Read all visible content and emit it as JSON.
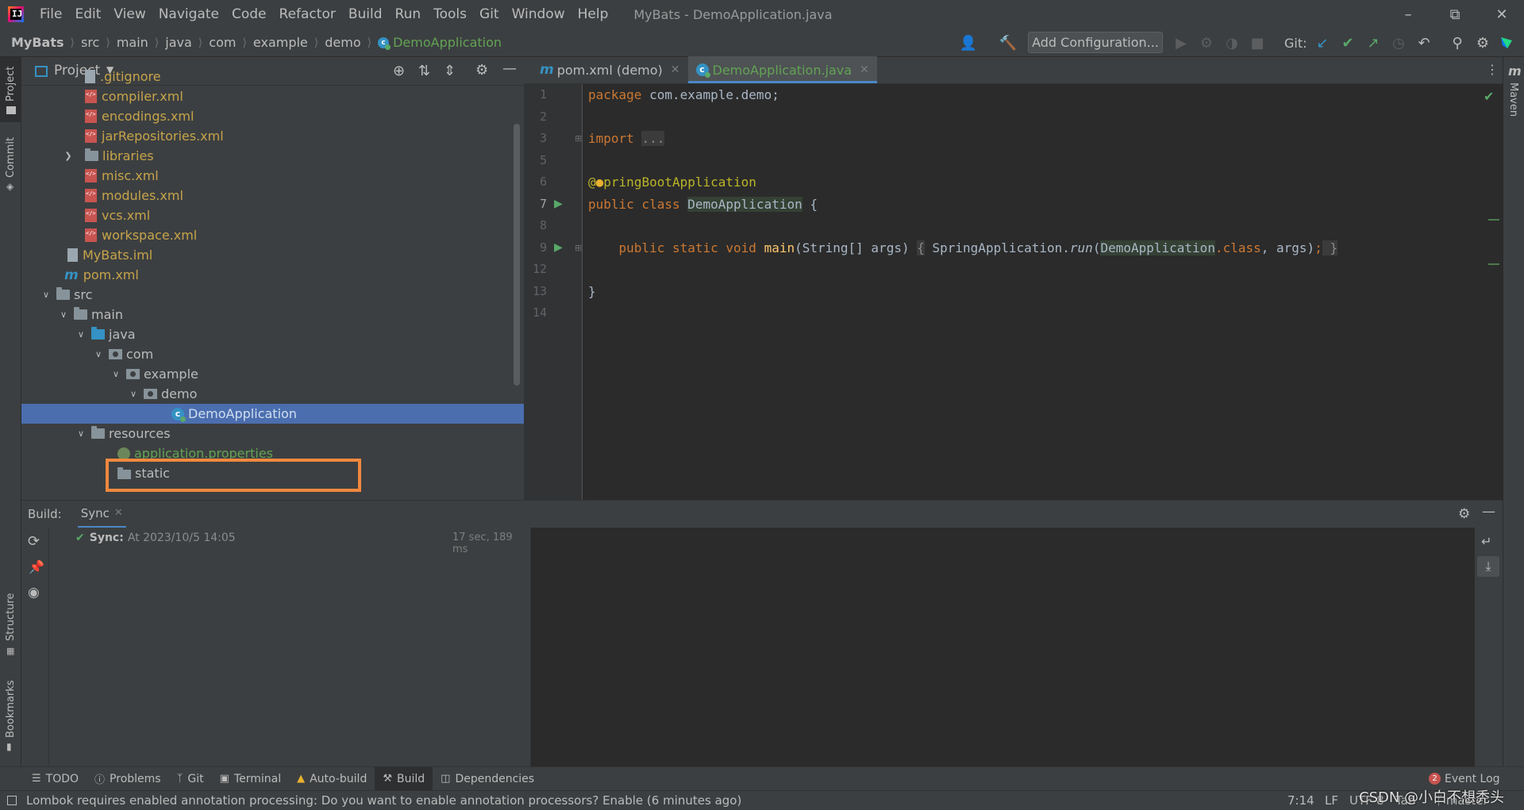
{
  "window": {
    "title": "MyBats - DemoApplication.java",
    "logo_letter": "IJ",
    "menu": [
      {
        "label": "File",
        "mnemonic": "F"
      },
      {
        "label": "Edit",
        "mnemonic": "E"
      },
      {
        "label": "View",
        "mnemonic": "V"
      },
      {
        "label": "Navigate",
        "mnemonic": "N"
      },
      {
        "label": "Code",
        "mnemonic": "C"
      },
      {
        "label": "Refactor",
        "mnemonic": "R"
      },
      {
        "label": "Build",
        "mnemonic": "B"
      },
      {
        "label": "Run",
        "mnemonic": "u"
      },
      {
        "label": "Tools",
        "mnemonic": "T"
      },
      {
        "label": "Git",
        "mnemonic": "G"
      },
      {
        "label": "Window",
        "mnemonic": "W"
      },
      {
        "label": "Help",
        "mnemonic": "H"
      }
    ]
  },
  "navbar": {
    "breadcrumbs": [
      "MyBats",
      "src",
      "main",
      "java",
      "com",
      "example",
      "demo",
      "DemoApplication"
    ],
    "add_configuration": "Add Configuration...",
    "git_label": "Git:"
  },
  "left_stripe": {
    "project": "Project",
    "commit": "Commit",
    "structure": "Structure",
    "bookmarks": "Bookmarks"
  },
  "right_stripe": {
    "maven": "Maven"
  },
  "project_panel": {
    "title": "Project",
    "tree": [
      {
        "label": ".gitignore",
        "icon": "file-icon",
        "color": "olive"
      },
      {
        "label": "compiler.xml",
        "icon": "xml-icon",
        "color": "olive"
      },
      {
        "label": "encodings.xml",
        "icon": "xml-icon",
        "color": "olive"
      },
      {
        "label": "jarRepositories.xml",
        "icon": "xml-icon",
        "color": "olive"
      },
      {
        "label": "libraries",
        "icon": "folder-icon",
        "color": "olive",
        "collapsed": true
      },
      {
        "label": "misc.xml",
        "icon": "xml-icon",
        "color": "olive"
      },
      {
        "label": "modules.xml",
        "icon": "xml-icon",
        "color": "olive"
      },
      {
        "label": "vcs.xml",
        "icon": "xml-icon",
        "color": "olive"
      },
      {
        "label": "workspace.xml",
        "icon": "xml-icon",
        "color": "olive"
      },
      {
        "label": "MyBats.iml",
        "icon": "file-icon",
        "color": "olive"
      },
      {
        "label": "pom.xml",
        "icon": "maven-icon",
        "color": "olive"
      },
      {
        "label": "src",
        "icon": "folder-icon",
        "color": "normal",
        "expanded": true
      },
      {
        "label": "main",
        "icon": "folder-icon",
        "color": "normal",
        "expanded": true
      },
      {
        "label": "java",
        "icon": "source-folder-icon",
        "color": "normal",
        "expanded": true
      },
      {
        "label": "com",
        "icon": "package-icon",
        "color": "normal",
        "expanded": true
      },
      {
        "label": "example",
        "icon": "package-icon",
        "color": "normal",
        "expanded": true
      },
      {
        "label": "demo",
        "icon": "package-icon",
        "color": "normal",
        "expanded": true
      },
      {
        "label": "DemoApplication",
        "icon": "class-icon",
        "color": "green",
        "selected": true
      },
      {
        "label": "resources",
        "icon": "resources-folder-icon",
        "color": "normal",
        "expanded": true
      },
      {
        "label": "application.properties",
        "icon": "properties-icon",
        "color": "green",
        "highlighted": true
      },
      {
        "label": "static",
        "icon": "folder-icon",
        "color": "normal"
      }
    ]
  },
  "editor": {
    "tabs": [
      {
        "label": "pom.xml (demo)",
        "icon": "maven-icon",
        "active": false
      },
      {
        "label": "DemoApplication.java",
        "icon": "class-icon",
        "active": true
      }
    ],
    "line_numbers": [
      "1",
      "2",
      "3",
      "5",
      "6",
      "7",
      "8",
      "9",
      "12",
      "13",
      "14"
    ],
    "code": {
      "l1_kw": "package",
      "l1_rest": " com.example.demo;",
      "l3_kw": "import",
      "l3_fold": "...",
      "l6_ann_at": "@",
      "l6_ann_rest": "pringBootApplication",
      "l7_kw": "public class",
      "l7_name": "DemoApplication",
      "l7_rest": " {",
      "l9_kw": "public static void",
      "l9_method": "main",
      "l9_params": "(String[] args)",
      "l9_open": "{",
      "l9_call_obj": " SpringApplication.",
      "l9_call_m": "run",
      "l9_paren_open": "(",
      "l9_arg_class": "DemoApplication",
      "l9_dot_class": ".class",
      "l9_args_end": ", args)",
      "l9_semi": ";",
      "l9_close": " }",
      "l13": "}"
    }
  },
  "build": {
    "label": "Build:",
    "tab": "Sync",
    "sync_title": "Sync:",
    "sync_text": "At 2023/10/5 14:05",
    "sync_time": "17 sec, 189 ms"
  },
  "bottom_tools": [
    {
      "label": "TODO",
      "icon": "list-icon"
    },
    {
      "label": "Problems",
      "icon": "problems-icon"
    },
    {
      "label": "Git",
      "icon": "branch-icon"
    },
    {
      "label": "Terminal",
      "icon": "terminal-icon"
    },
    {
      "label": "Auto-build",
      "icon": "warning-icon"
    },
    {
      "label": "Build",
      "icon": "hammer-icon",
      "active": true
    },
    {
      "label": "Dependencies",
      "icon": "stack-icon"
    }
  ],
  "event_log": {
    "label": "Event Log",
    "count": "2"
  },
  "status": {
    "message": "Lombok requires enabled annotation processing: Do you want to enable annotation processors? Enable (6 minutes ago)",
    "position": "7:14",
    "line_sep": "LF",
    "encoding": "UTF-8",
    "indent": "Tab",
    "branch": "master",
    "watermark": "CSDN @小白不想秃头"
  },
  "colors": {
    "accent": "#4a88c7",
    "selection": "#4b6eaf",
    "highlight_box": "#f0883e",
    "file_olive": "#c6a44a",
    "file_green": "#62a354"
  }
}
